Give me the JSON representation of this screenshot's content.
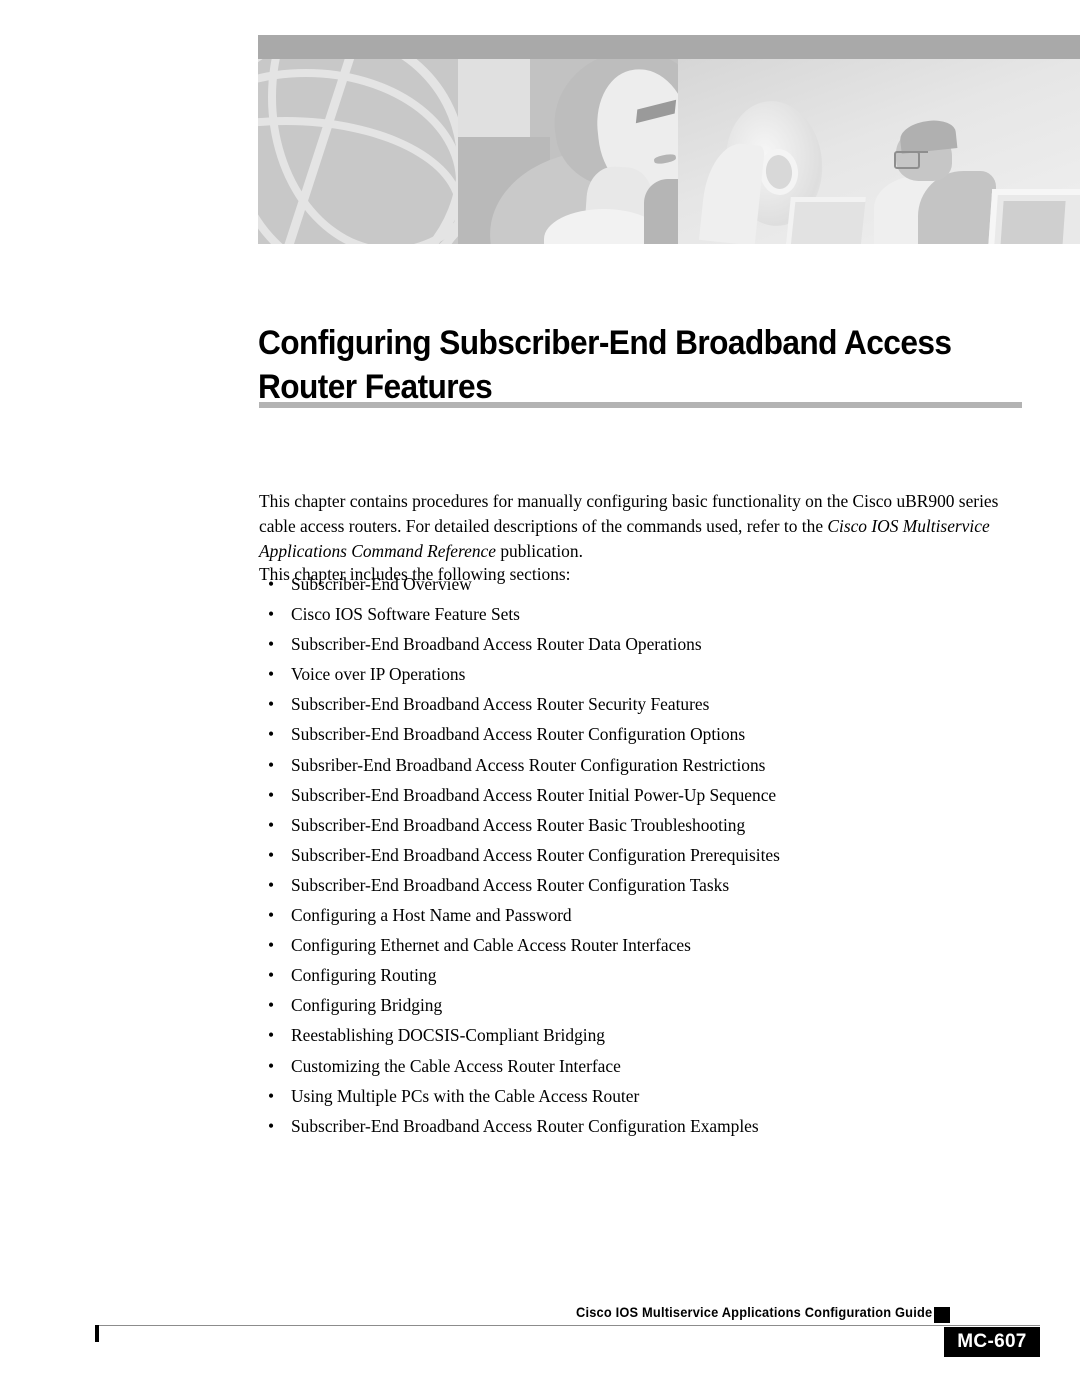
{
  "document": {
    "chapter_title": "Configuring Subscriber-End Broadband Access Router Features",
    "intro_part1": "This chapter contains procedures for manually configuring basic functionality on the Cisco uBR900 series cable access routers. For detailed descriptions of the commands used, refer to the ",
    "intro_italic": "Cisco IOS Multiservice Applications Command Reference",
    "intro_part2": " publication.",
    "includes_line": "This chapter includes the following sections:",
    "bullet_marker": "•",
    "sections": [
      "Subscriber-End Overview",
      "Cisco IOS Software Feature Sets",
      "Subscriber-End Broadband Access Router Data Operations",
      "Voice over IP Operations",
      "Subscriber-End Broadband Access Router Security Features",
      "Subscriber-End Broadband Access Router Configuration Options",
      "Subsriber-End Broadband Access Router Configuration Restrictions",
      "Subscriber-End Broadband Access Router Initial Power-Up Sequence",
      "Subscriber-End Broadband Access Router Basic Troubleshooting",
      "Subscriber-End Broadband Access Router Configuration Prerequisites",
      "Subscriber-End Broadband Access Router Configuration Tasks",
      "Configuring a Host Name and Password",
      "Configuring Ethernet and Cable Access Router Interfaces",
      "Configuring Routing",
      "Configuring Bridging",
      "Reestablishing DOCSIS-Compliant Bridging",
      "Customizing the Cable Access Router Interface",
      "Using Multiple PCs with the Cable Access Router",
      "Subscriber-End Broadband Access Router Configuration Examples"
    ]
  },
  "footer": {
    "guide_title": "Cisco IOS Multiservice Applications Configuration Guide",
    "page_number": "MC-607"
  },
  "colors": {
    "title_rule": "#b3b3b3",
    "banner_strip": "#a9a9a9",
    "badge_background": "#000000",
    "badge_text": "#ffffff"
  }
}
